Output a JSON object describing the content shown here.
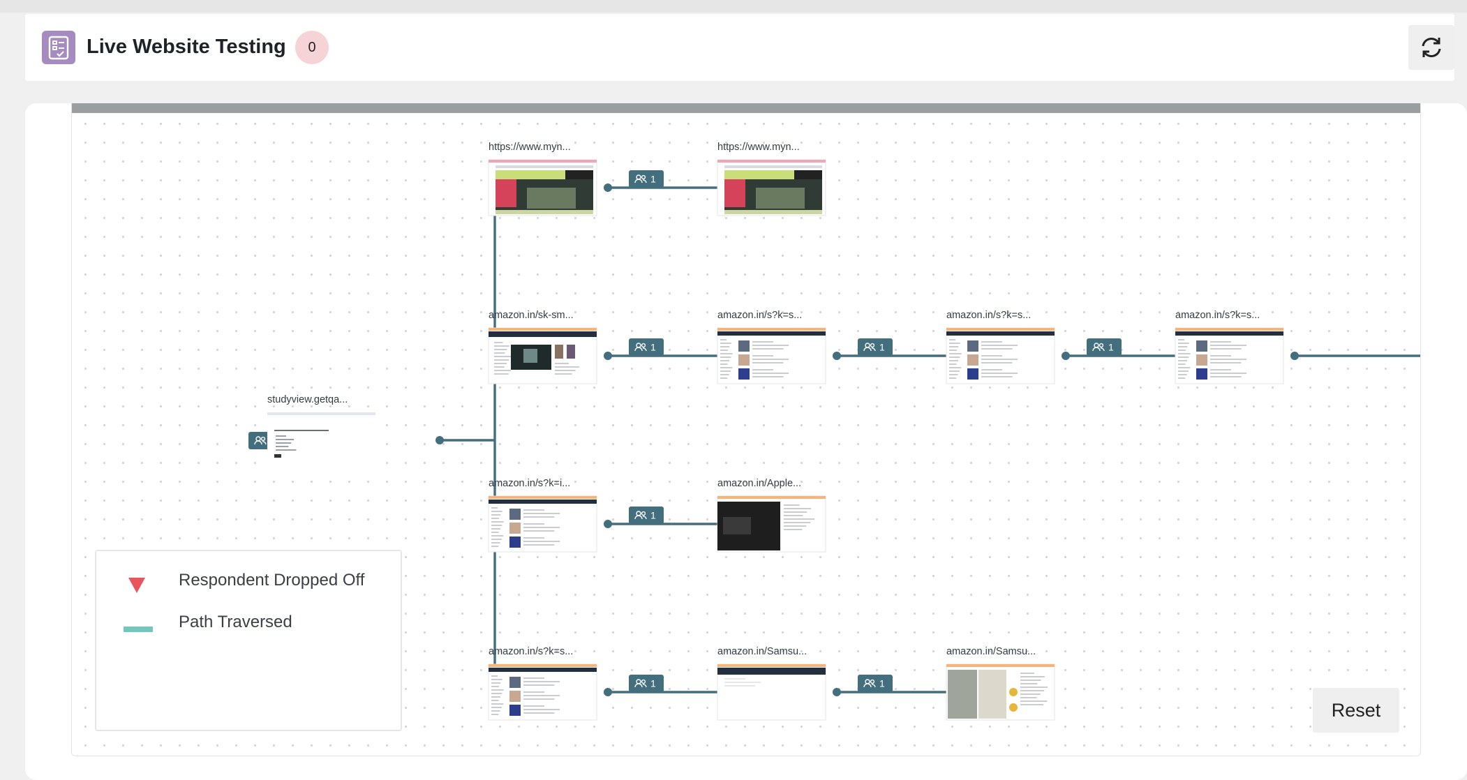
{
  "header": {
    "title": "Live Website Testing",
    "badge_count": "0",
    "icon": "checklist-icon",
    "refresh_icon": "refresh-icon"
  },
  "legend": {
    "dropped_off_label": "Respondent Dropped Off",
    "path_traversed_label": "Path Traversed",
    "dropped_off_color": "#e9545d",
    "path_traversed_color": "#72c6bb"
  },
  "reset_label": "Reset",
  "colors": {
    "edge": "#436e7d",
    "count_badge": "#436e7d"
  },
  "flow": {
    "nodes": [
      {
        "id": "n0",
        "label": "studyview.getqa...",
        "count": "1",
        "kind": "study"
      },
      {
        "id": "n1",
        "label": "https://www.myn...",
        "count": "1",
        "kind": "myntra"
      },
      {
        "id": "n2",
        "label": "https://www.myn...",
        "count": "1",
        "kind": "myntra"
      },
      {
        "id": "n3",
        "label": "amazon.in/sk-sm...",
        "count": "1",
        "kind": "amz_video"
      },
      {
        "id": "n4",
        "label": "amazon.in/s?k=s...",
        "count": "1",
        "kind": "amz_list"
      },
      {
        "id": "n5",
        "label": "amazon.in/s?k=s...",
        "count": "1",
        "kind": "amz_list"
      },
      {
        "id": "n6",
        "label": "amazon.in/s?k=s...",
        "count": "1",
        "kind": "amz_list"
      },
      {
        "id": "n7",
        "label": "amazon.in/s?k=i...",
        "count": "1",
        "kind": "amz_list"
      },
      {
        "id": "n8",
        "label": "amazon.in/Apple...",
        "count": "1",
        "kind": "amz_dark"
      },
      {
        "id": "n9",
        "label": "amazon.in/s?k=s...",
        "count": "1",
        "kind": "amz_list"
      },
      {
        "id": "n10",
        "label": "amazon.in/Samsu...",
        "count": "1",
        "kind": "amz_blank"
      },
      {
        "id": "n11",
        "label": "amazon.in/Samsu...",
        "count": "1",
        "kind": "amz_phone"
      }
    ]
  }
}
